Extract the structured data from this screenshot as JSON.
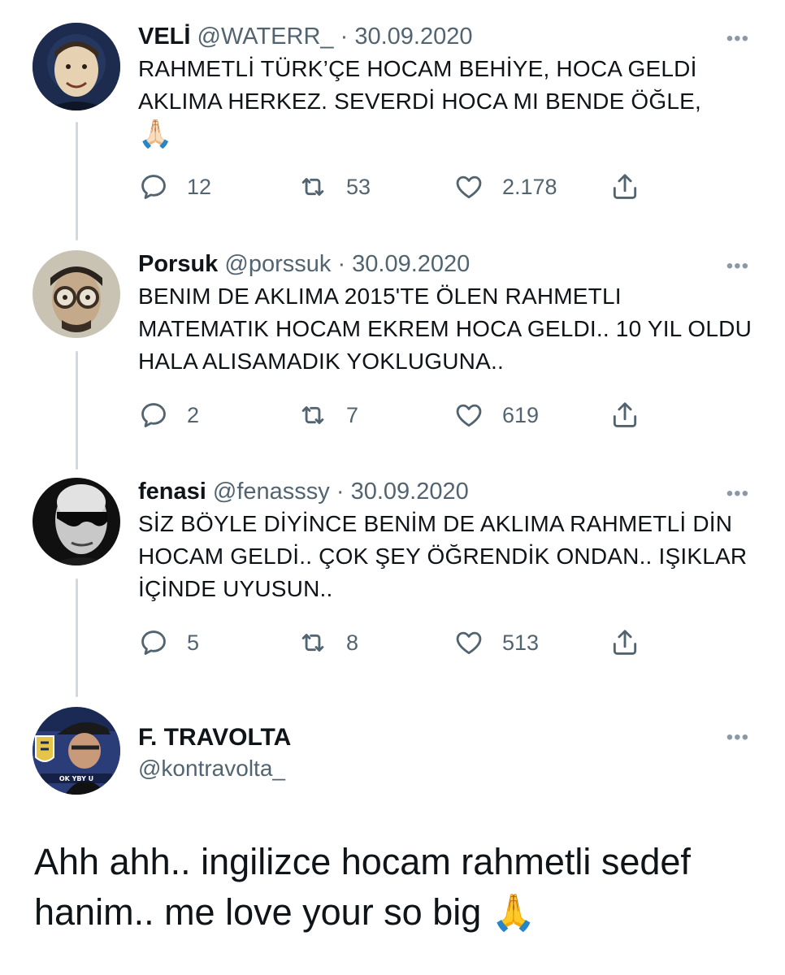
{
  "tweets": [
    {
      "name": "VELİ",
      "handle": "@WATERR_",
      "sep": "·",
      "date": "30.09.2020",
      "text": "RAHMETLİ TÜRK’ÇE HOCAM BEHİYE, HOCA GELDİ AKLIMA HERKEZ. SEVERDİ HOCA MI BENDE ÖĞLE,",
      "emoji": "🙏🏻",
      "replies": "12",
      "retweets": "53",
      "likes": "2.178"
    },
    {
      "name": "Porsuk",
      "handle": "@porssuk",
      "sep": "·",
      "date": "30.09.2020",
      "text": "BENIM DE AKLIMA 2015'TE ÖLEN RAHMETLI MATEMATIK HOCAM EKREM HOCA GELDI.. 10 YIL OLDU HALA ALISAMADIK YOKLUGUNA..",
      "replies": "2",
      "retweets": "7",
      "likes": "619"
    },
    {
      "name": "fenasi",
      "handle": "@fenasssy",
      "sep": "·",
      "date": "30.09.2020",
      "text": "SİZ BÖYLE DİYİNCE BENİM DE AKLIMA RAHMETLİ DİN HOCAM GELDİ.. ÇOK ŞEY ÖĞRENDİK ONDAN.. IŞIKLAR İÇİNDE UYUSUN..",
      "replies": "5",
      "retweets": "8",
      "likes": "513"
    }
  ],
  "main_tweet": {
    "name": "F. TRAVOLTA",
    "handle": "@kontravolta_",
    "avatar_caption": "OK YBY U",
    "text": "Ahh ahh.. ingilizce hocam rahmetli sedef hanim.. me love your so big",
    "emoji": "🙏"
  },
  "icons": {
    "more": "more-icon",
    "reply": "reply-icon",
    "retweet": "retweet-icon",
    "like": "like-icon",
    "share": "share-icon"
  },
  "colors": {
    "text": "#0f1419",
    "secondary": "#536471",
    "thread_line": "#cfd9de"
  }
}
